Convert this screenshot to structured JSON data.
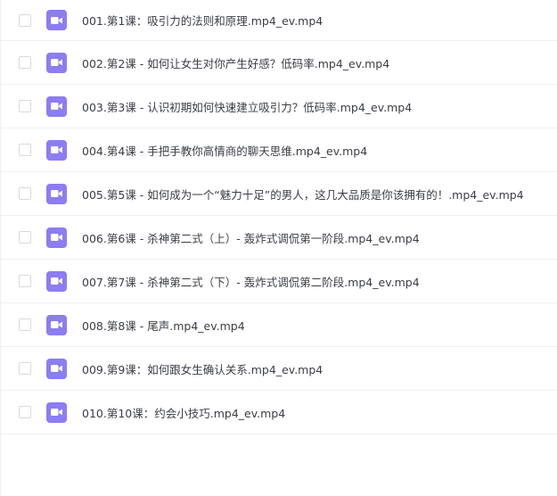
{
  "files": [
    {
      "name": "001.第1课：吸引力的法则和原理.mp4_ev.mp4",
      "icon": "video-file-icon"
    },
    {
      "name": "002.第2课 - 如何让女生对你产生好感？低码率.mp4_ev.mp4",
      "icon": "video-file-icon"
    },
    {
      "name": "003.第3课 - 认识初期如何快速建立吸引力？低码率.mp4_ev.mp4",
      "icon": "video-file-icon"
    },
    {
      "name": "004.第4课 - 手把手教你高情商的聊天思维.mp4_ev.mp4",
      "icon": "video-file-icon"
    },
    {
      "name": "005.第5课 - 如何成为一个“魅力十足”的男人，这几大品质是你该拥有的！.mp4_ev.mp4",
      "icon": "video-file-icon"
    },
    {
      "name": "006.第6课 - 杀神第二式（上）- 轰炸式调侃第一阶段.mp4_ev.mp4",
      "icon": "video-file-icon"
    },
    {
      "name": "007.第7课 - 杀神第二式（下）- 轰炸式调侃第二阶段.mp4_ev.mp4",
      "icon": "video-file-icon"
    },
    {
      "name": "008.第8课 - 尾声.mp4_ev.mp4",
      "icon": "video-file-icon"
    },
    {
      "name": "009.第9课：如何跟女生确认关系.mp4_ev.mp4",
      "icon": "video-file-icon"
    },
    {
      "name": "010.第10课：约会小技巧.mp4_ev.mp4",
      "icon": "video-file-icon"
    }
  ],
  "colors": {
    "icon_bg": "#8b7df2",
    "text": "#3a3d44",
    "divider": "#eef0f3"
  }
}
